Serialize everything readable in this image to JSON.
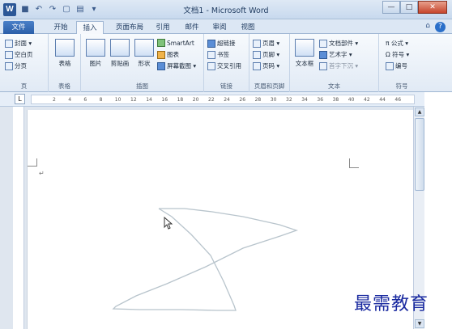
{
  "window": {
    "title": "文档1 - Microsoft Word",
    "app_icon": "W",
    "minimize": "—",
    "maximize": "□",
    "close": "✕"
  },
  "tabs": [
    "文件",
    "开始",
    "插入",
    "页面布局",
    "引用",
    "邮件",
    "审阅",
    "视图"
  ],
  "active_tab": "插入",
  "ribbon": {
    "pages": {
      "label": "页",
      "items": [
        "封面 ▾",
        "空白页",
        "分页"
      ]
    },
    "tables": {
      "label": "表格",
      "button": "表格"
    },
    "illustrations": {
      "label": "插图",
      "picture": "图片",
      "clipart": "剪贴画",
      "shapes": "形状",
      "smartart": "SmartArt",
      "chart": "图表",
      "screenshot": "屏幕截图 ▾"
    },
    "links": {
      "label": "链接",
      "items": [
        "超链接",
        "书签",
        "交叉引用"
      ]
    },
    "header_footer": {
      "label": "页眉和页脚",
      "items": [
        "页眉 ▾",
        "页脚 ▾",
        "页码 ▾"
      ]
    },
    "text": {
      "label": "文本",
      "textbox": "文本框",
      "items": [
        "文档部件 ▾",
        "艺术字 ▾",
        "首字下沉 ▾"
      ]
    },
    "symbols": {
      "label": "符号",
      "items": [
        "π 公式 ▾",
        "Ω 符号 ▾",
        "编号"
      ]
    }
  },
  "ruler": {
    "numbers": [
      "2",
      "4",
      "6",
      "8",
      "10",
      "12",
      "14",
      "16",
      "18",
      "20",
      "22",
      "24",
      "26",
      "28",
      "30",
      "32",
      "34",
      "36",
      "38",
      "40",
      "42",
      "44",
      "46"
    ]
  },
  "document": {
    "paragraph_mark": "↵"
  },
  "watermark": "最需教育"
}
